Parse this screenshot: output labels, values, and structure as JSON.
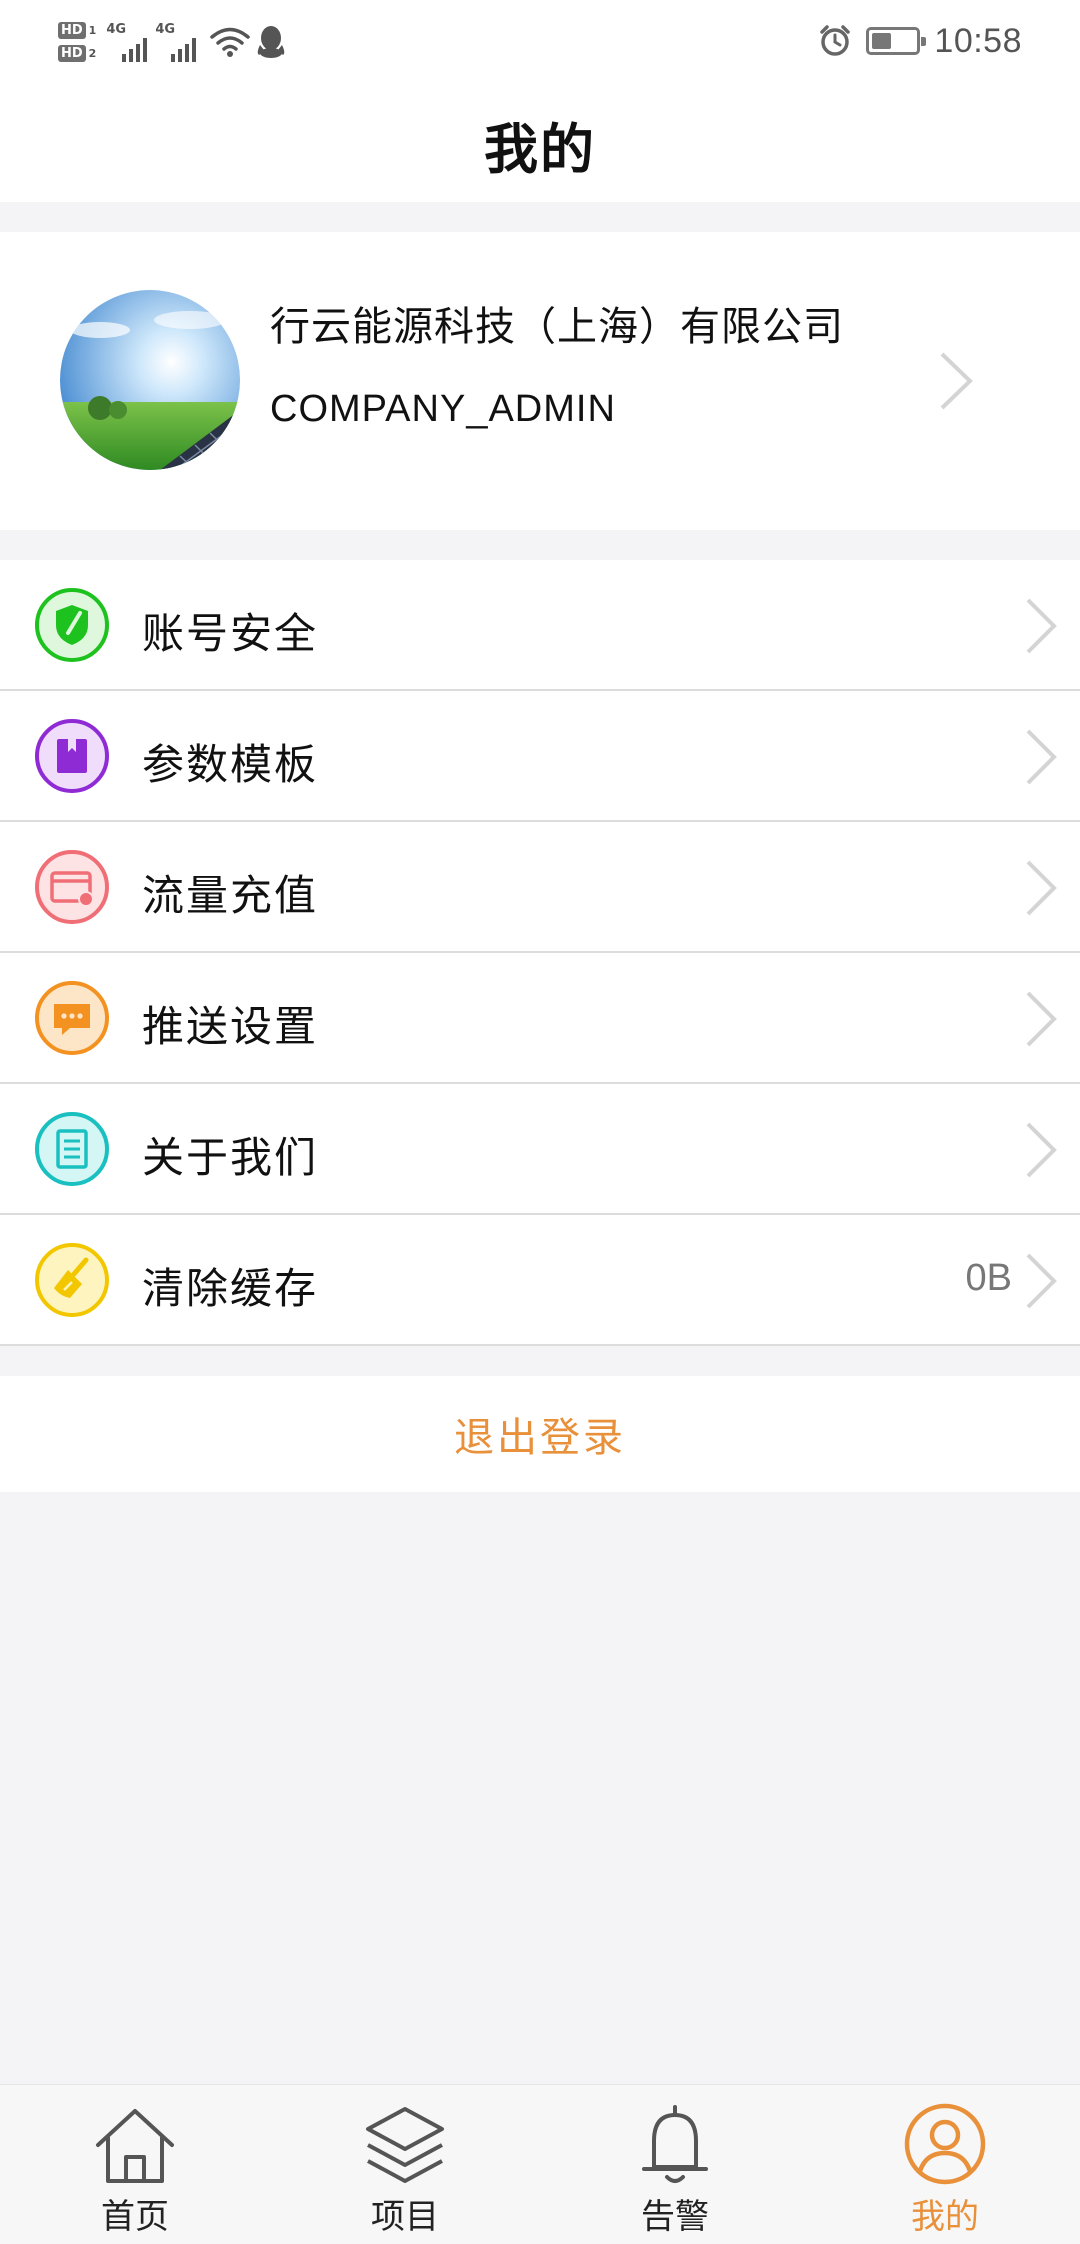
{
  "status_bar": {
    "sim1": {
      "hd": "HD",
      "slot": "1",
      "network": "4G"
    },
    "sim2": {
      "hd": "HD",
      "slot": "2",
      "network": "4G"
    },
    "time": "10:58",
    "battery_level": 0.45,
    "icons": [
      "signal-icon",
      "wifi-icon",
      "qq-icon",
      "alarm-icon",
      "battery-icon"
    ]
  },
  "header": {
    "title": "我的"
  },
  "profile": {
    "company": "行云能源科技（上海）有限公司",
    "role": "COMPANY_ADMIN"
  },
  "menu": {
    "items": [
      {
        "label": "账号安全",
        "icon": "shield-icon",
        "color": "#1ec21e"
      },
      {
        "label": "参数模板",
        "icon": "bookmark-icon",
        "color": "#8f2bd4"
      },
      {
        "label": "流量充值",
        "icon": "card-icon",
        "color": "#f06e76"
      },
      {
        "label": "推送设置",
        "icon": "chat-icon",
        "color": "#f39221"
      },
      {
        "label": "关于我们",
        "icon": "document-icon",
        "color": "#19c0bf"
      },
      {
        "label": "清除缓存",
        "icon": "broom-icon",
        "color": "#f2c700",
        "value": "0B"
      }
    ]
  },
  "logout": {
    "label": "退出登录",
    "color": "#e8903a"
  },
  "bottom_nav": {
    "items": [
      {
        "label": "首页",
        "icon": "home-icon"
      },
      {
        "label": "项目",
        "icon": "layers-icon"
      },
      {
        "label": "告警",
        "icon": "bell-icon"
      },
      {
        "label": "我的",
        "icon": "user-icon",
        "active": true
      }
    ],
    "active_color": "#e8903a"
  }
}
